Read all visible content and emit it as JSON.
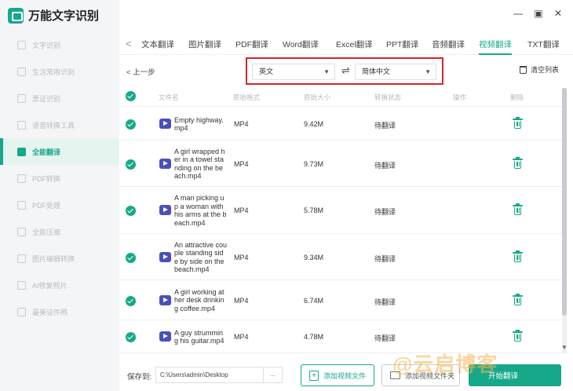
{
  "app": {
    "title": "万能文字识别"
  },
  "window_controls": {
    "minimize": "—",
    "maximize": "▣",
    "close": "✕"
  },
  "sidebar": {
    "items": [
      {
        "label": "文字识别"
      },
      {
        "label": "生活常用识别"
      },
      {
        "label": "票证识别"
      },
      {
        "label": "语音转换工具"
      },
      {
        "label": "全能翻译",
        "active": true
      },
      {
        "label": "PDF转换"
      },
      {
        "label": "PDF处理"
      },
      {
        "label": "全能压缩"
      },
      {
        "label": "图片编辑转换"
      },
      {
        "label": "AI修复照片"
      },
      {
        "label": "最美证件照"
      }
    ]
  },
  "tabs": {
    "prev_arrow": "<",
    "items": [
      {
        "label": "文本翻译"
      },
      {
        "label": "图片翻译"
      },
      {
        "label": "PDF翻译"
      },
      {
        "label": "Word翻译"
      },
      {
        "label": "Excel翻译"
      },
      {
        "label": "PPT翻译"
      },
      {
        "label": "音频翻译"
      },
      {
        "label": "视频翻译",
        "active": true
      },
      {
        "label": "TXT翻译"
      }
    ]
  },
  "toolbar": {
    "back_label": "< 上一步",
    "source_lang": "英文",
    "target_lang": "简体中文",
    "swap_symbol": "⇌",
    "caret": "▼",
    "clear_label": "清空列表"
  },
  "table": {
    "headers": [
      "文件名",
      "原始格式",
      "原始大小",
      "转换状态",
      "操作",
      "删除"
    ],
    "rows": [
      {
        "name": "Empty highway.\nmp4",
        "format": "MP4",
        "size": "9.42M",
        "status": "待翻译"
      },
      {
        "name": "A girl wrapped h\ner in a towel sta\nnding on the be\nach.mp4",
        "format": "MP4",
        "size": "9.73M",
        "status": "待翻译"
      },
      {
        "name": "A man picking u\np a woman with\nhis arms at the b\neach.mp4",
        "format": "MP4",
        "size": "5.78M",
        "status": "待翻译"
      },
      {
        "name": "An attractive cou\nple standing sid\ne by side on the\nbeach.mp4",
        "format": "MP4",
        "size": "9.34M",
        "status": "待翻译"
      },
      {
        "name": "A girl working at\nher desk drinkin\ng coffee.mp4",
        "format": "MP4",
        "size": "6.74M",
        "status": "待翻译"
      },
      {
        "name": "A guy strummin\ng his guitar.mp4",
        "format": "MP4",
        "size": "4.78M",
        "status": "待翻译"
      }
    ]
  },
  "bottom": {
    "save_label": "保存到:",
    "save_path": "C:\\Users\\admin\\Desktop",
    "browse_label": "...",
    "add_file_label": "添加视频文件",
    "add_folder_label": "添加视频文件夹",
    "start_label": "开始翻译"
  },
  "watermark": "@云启博客",
  "colors": {
    "accent": "#17a88a",
    "highlight_border": "#d2262f",
    "file_icon": "#4a4fbe"
  }
}
